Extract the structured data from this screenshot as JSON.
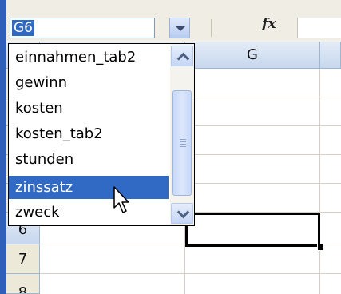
{
  "name_box": {
    "value": "G6"
  },
  "formula_bar": {
    "fx_label": "fx",
    "value": ""
  },
  "columns": [
    {
      "label": "",
      "id": "prev"
    },
    {
      "label": "G",
      "id": "g"
    },
    {
      "label": "",
      "id": "next"
    }
  ],
  "rows": [
    "",
    "",
    "",
    "",
    "",
    "6",
    "7",
    "8"
  ],
  "name_list": {
    "items": [
      "einnahmen_tab2",
      "gewinn",
      "kosten",
      "kosten_tab2",
      "stunden",
      "zinssatz",
      "zweck"
    ],
    "selected": "zinssatz"
  },
  "colors": {
    "selection": "#316ac5",
    "header": "#c7d7ee",
    "accent_strip": "#2f5fb8"
  }
}
